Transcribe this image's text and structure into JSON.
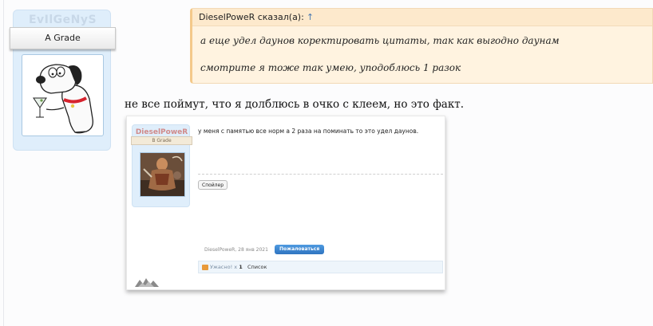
{
  "user": {
    "name": "EvIlGeNyS",
    "rank": "A Grade",
    "avatar_icon": "family-guy-brian-dog-icon"
  },
  "quote": {
    "author": "DieselPoweR сказал(а):",
    "arrow": "↑",
    "lines": [
      "а еще удел даунов коректировать цитаты, так как выгодно даунам",
      "смотрите я тоже так умею, уподоблюсь 1 разок"
    ]
  },
  "post": {
    "text": "не все поймут, что я долблюсь в очко с клеем, но это факт."
  },
  "embed": {
    "user_name": "DieselPoweR",
    "user_rank": "B Grade",
    "avatar_icon": "warrior-avatar-icon",
    "text": "у меня с памятью все норм а 2 раза на поминать то это удел даунов.",
    "spoiler_label": "Спойлер",
    "meta": "DieselPoweR, 28 янв 2021",
    "complain_label": "Пожаловаться",
    "reaction": "Ужасно! x",
    "reaction_count": "1",
    "list_label": "Список",
    "logo_icon": "site-logo-icon"
  },
  "colors": {
    "card_bg": "#dfeefb",
    "quote_bg": "#fff3e0",
    "complain_button": "#3a84d0"
  }
}
